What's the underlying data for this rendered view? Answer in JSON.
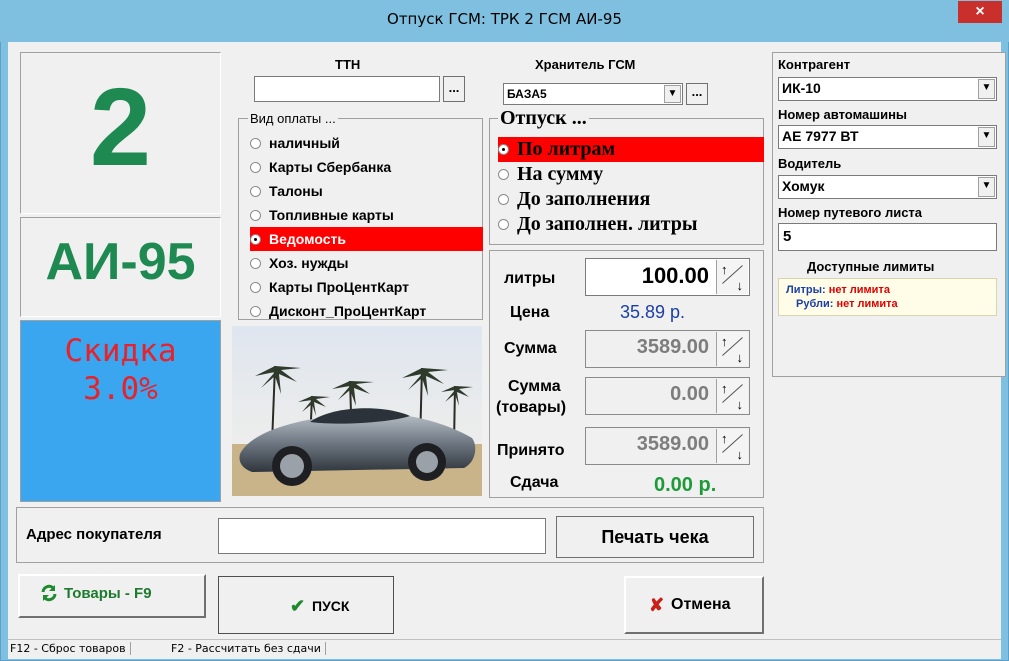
{
  "window": {
    "title": "Отпуск ГСМ:  ТРК 2  ГСМ АИ-95",
    "close": "×"
  },
  "left": {
    "pump_number": "2",
    "fuel_name": "АИ-95",
    "discount_label": "Скидка",
    "discount_value": "3.0%",
    "discount_bg": "#3aa6f0"
  },
  "ttn": {
    "label": "ТТН",
    "value": "",
    "browse": "..."
  },
  "storage": {
    "label": "Хранитель ГСМ",
    "value": "БАЗА5",
    "browse": "..."
  },
  "payment": {
    "title": "Вид оплаты ...",
    "options": [
      "наличный",
      "Карты Сбербанка",
      "Талоны",
      "Топливные карты",
      "Ведомость",
      "Хоз. нужды",
      "Карты ПроЦентКарт",
      "Дисконт_ПроЦентКарт"
    ],
    "selected_index": 4
  },
  "release": {
    "title": "Отпуск ...",
    "options": [
      "По литрам",
      "На сумму",
      "До заполнения",
      "До заполнен. литры"
    ],
    "selected_index": 0
  },
  "calc": {
    "liters_label": "литры",
    "liters_value": "100.00",
    "price_label": "Цена",
    "price_value": "35.89 р.",
    "sum_label": "Сумма",
    "sum_value": "3589.00",
    "goods_label_1": "Сумма",
    "goods_label_2": "(товары)",
    "goods_value": "0.00",
    "received_label": "Принято",
    "received_value": "3589.00",
    "change_label": "Сдача",
    "change_value": "0.00 р."
  },
  "right": {
    "counterparty_label": "Контрагент",
    "counterparty_value": "ИК-10",
    "car_label": "Номер автомашины",
    "car_value": "АЕ 7977 ВТ",
    "driver_label": "Водитель",
    "driver_value": "Хомук",
    "waybill_label": "Номер путевого листа",
    "waybill_value": "5",
    "limits_title": "Доступные лимиты",
    "liters_limit_label": "Литры:",
    "liters_limit_value": "нет лимита",
    "rubles_limit_label": "Рубли:",
    "rubles_limit_value": "нет лимита"
  },
  "bottom": {
    "address_label": "Адрес покупателя",
    "address_value": "",
    "print_button": "Печать чека",
    "goods_button": "Товары - F9",
    "start_button": "ПУСК",
    "cancel_button": "Отмена"
  },
  "status": {
    "f12": "F12 - Сброс товаров",
    "f2": "F2 - Рассчитать без сдачи"
  },
  "colors": {
    "selected_row": "#ff0000",
    "fuel_green": "#1e8a52",
    "discount_red": "#e8222a",
    "price_blue": "#1a3fa8",
    "change_green": "#1f9a3a"
  }
}
